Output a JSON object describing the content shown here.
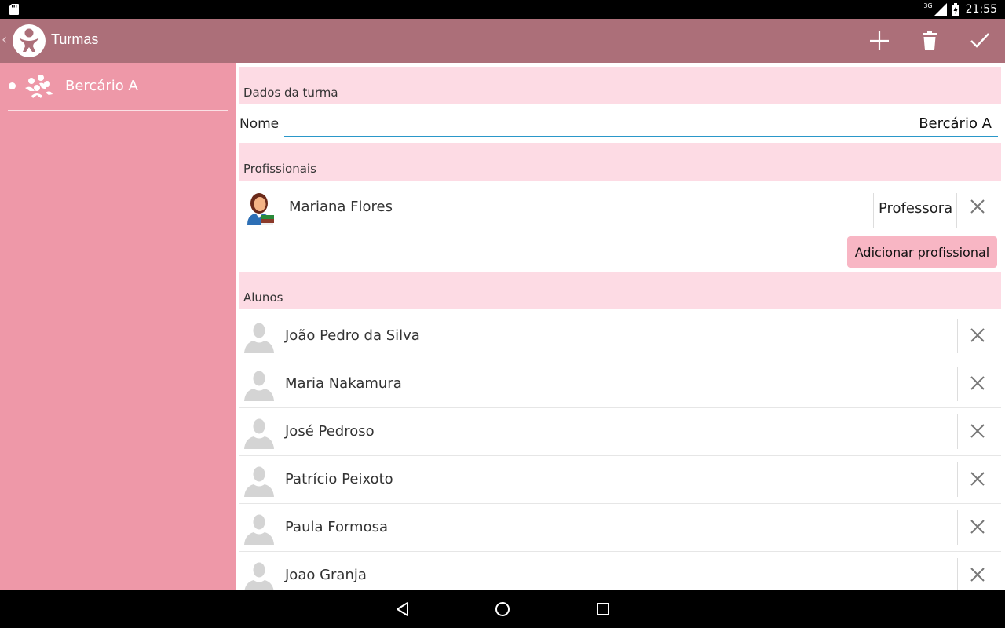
{
  "status_bar": {
    "time": "21:55",
    "network": "3G",
    "icons": [
      "sd-card-icon",
      "signal-icon",
      "battery-icon"
    ]
  },
  "action_bar": {
    "title": "Turmas",
    "back_icon": "chevron-left-icon",
    "logo_icon": "baby-logo-icon",
    "actions": [
      {
        "name": "add",
        "icon": "plus-icon"
      },
      {
        "name": "delete",
        "icon": "trash-icon"
      },
      {
        "name": "confirm",
        "icon": "check-icon"
      }
    ]
  },
  "sidebar": {
    "items": [
      {
        "label": "Bercário A",
        "icon": "group-icon",
        "selected": true
      }
    ]
  },
  "main": {
    "class_section": {
      "header": "Dados da turma",
      "name_label": "Nome",
      "name_value": "Bercário A"
    },
    "professionals_section": {
      "header": "Profissionais",
      "items": [
        {
          "name": "Mariana Flores",
          "role": "Professora",
          "avatar": "teacher-avatar-icon"
        }
      ],
      "add_button": "Adicionar profissional"
    },
    "students_section": {
      "header": "Alunos",
      "items": [
        {
          "name": "João Pedro da Silva"
        },
        {
          "name": "Maria Nakamura"
        },
        {
          "name": "José Pedroso"
        },
        {
          "name": "Patrício Peixoto"
        },
        {
          "name": "Paula Formosa"
        },
        {
          "name": "Joao Granja"
        }
      ]
    }
  },
  "nav_bar": {
    "buttons": [
      "back-triangle-icon",
      "home-circle-icon",
      "recents-square-icon"
    ]
  },
  "colors": {
    "action_bar": "#ac6f79",
    "sidebar": "#ee98a8",
    "section_header": "#fddbe4",
    "add_button": "#f8b6c4",
    "input_underline": "#2a97c9"
  }
}
